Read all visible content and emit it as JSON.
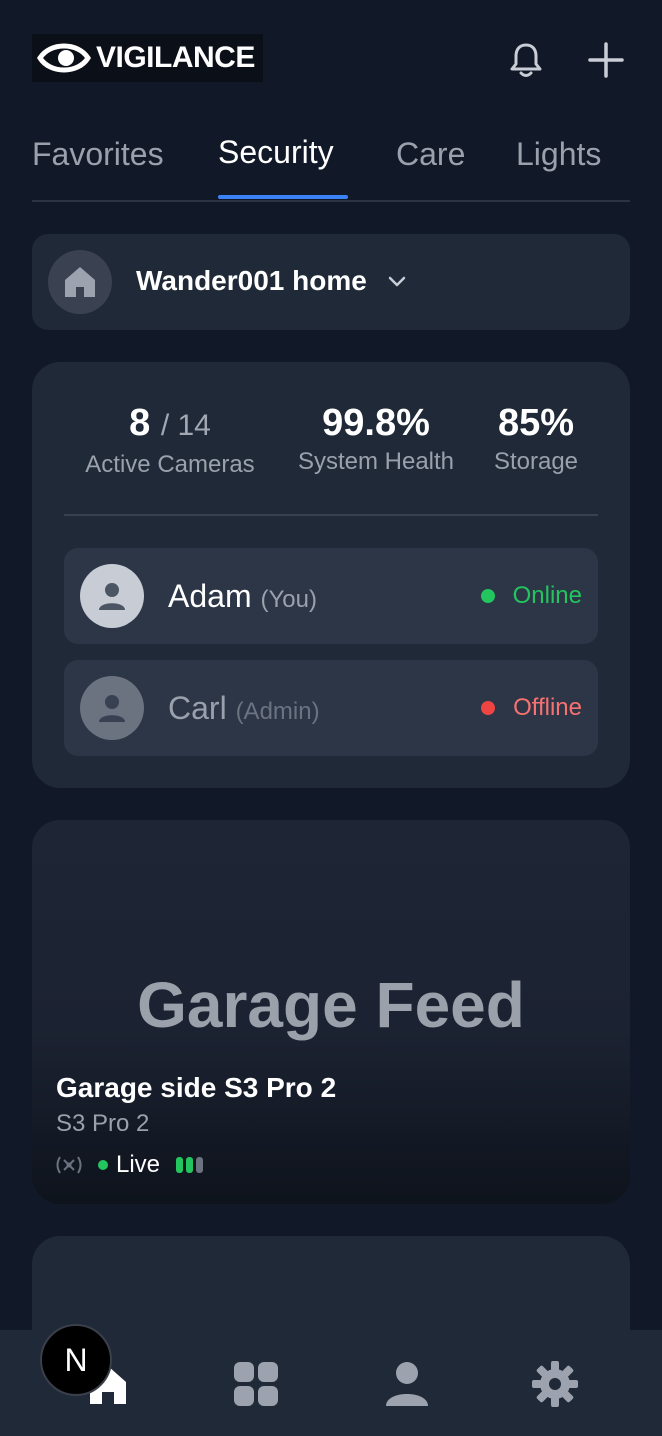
{
  "app": {
    "brand": "VIGILANCE"
  },
  "header": {
    "bell_icon": "bell-icon",
    "add_icon": "plus-icon"
  },
  "tabs": [
    {
      "label": "Favorites",
      "active": false
    },
    {
      "label": "Security",
      "active": true
    },
    {
      "label": "Care",
      "active": false
    },
    {
      "label": "Lights",
      "active": false
    }
  ],
  "home_selector": {
    "name": "Wander001 home",
    "icon": "home-icon",
    "chevron": "chevron-down-icon"
  },
  "stats": {
    "active_cameras": "8",
    "total_cameras": "/ 14",
    "active_cameras_label": "Active Cameras",
    "system_health": "99.8%",
    "system_health_label": "System Health",
    "storage": "85%",
    "storage_label": "Storage"
  },
  "users": [
    {
      "name": "Adam",
      "role": "(You)",
      "status": "Online",
      "status_color": "#22c55e"
    },
    {
      "name": "Carl",
      "role": "(Admin)",
      "status": "Offline",
      "status_color": "#ef4444"
    }
  ],
  "feed": {
    "placeholder_title": "Garage Feed",
    "camera_name": "Garage side S3 Pro 2",
    "model": "S3 Pro 2",
    "live_label": "Live",
    "signal_bars": [
      true,
      true,
      false
    ]
  },
  "bottom_nav": [
    {
      "icon": "home-icon",
      "active": true
    },
    {
      "icon": "grid-icon",
      "active": false
    },
    {
      "icon": "user-icon",
      "active": false
    },
    {
      "icon": "gear-icon",
      "active": false
    }
  ],
  "dev_badge": {
    "label": "N"
  },
  "colors": {
    "accent": "#3b82f6",
    "online": "#22c55e",
    "offline": "#ef4444",
    "background": "#111827",
    "card": "#1f2937"
  }
}
